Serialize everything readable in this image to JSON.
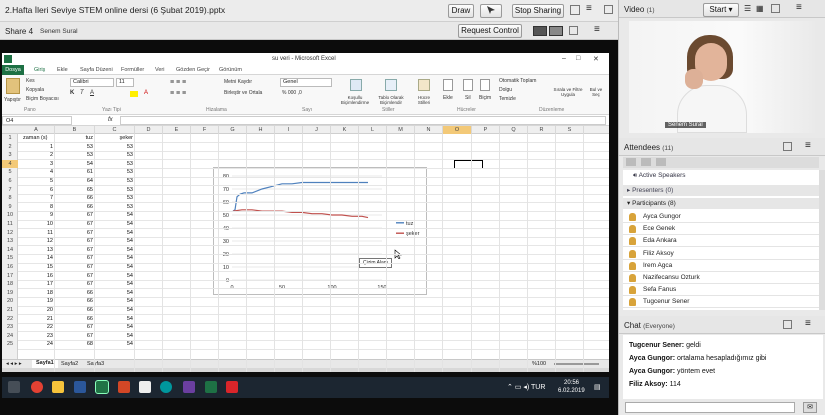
{
  "window": {
    "title": "2.Hafta İleri Seviye STEM online dersi (6 Şubat 2019).pptx",
    "draw": "Draw",
    "stop_sharing": "Stop Sharing"
  },
  "share": {
    "label": "Share 4",
    "presenter": "Senem Sural",
    "request_control": "Request Control"
  },
  "excel": {
    "title": "su veri - Microsoft Excel",
    "tabs": [
      "Dosya",
      "Giriş",
      "Ekle",
      "Sayfa Düzeni",
      "Formüller",
      "Veri",
      "Gözden Geçir",
      "Görünüm"
    ],
    "clipboard": {
      "cut": "Kes",
      "copy": "Kopyala",
      "format_painter": "Biçim Boyacısı",
      "paste": "Yapıştır",
      "group": "Pano"
    },
    "font": {
      "name": "Calibri",
      "size": "11",
      "group": "Yazı Tipi"
    },
    "alignment": {
      "wrap": "Metni Kaydır",
      "merge": "Birleştir ve Ortala",
      "group": "Hizalama"
    },
    "number": {
      "format": "Genel",
      "group": "Sayı"
    },
    "styles": {
      "conditional": "Koşullu Biçimlendirme",
      "table": "Tablo Olarak Biçimlendir",
      "cell": "Hücre Stilleri",
      "group": "Stiller"
    },
    "cells": {
      "insert": "Ekle",
      "delete": "Sil",
      "format": "Biçim",
      "group": "Hücreler"
    },
    "editing": {
      "autosum": "Otomatik Toplam",
      "fill": "Dolgu",
      "clear": "Temizle",
      "sort": "Sırala ve Filtre Uygula",
      "find": "Bul ve Seç",
      "group": "Düzenleme"
    },
    "namebox": "O4",
    "fx": "fx",
    "columns": [
      "A",
      "B",
      "C",
      "D",
      "E",
      "F",
      "G",
      "H",
      "I",
      "J",
      "K",
      "L",
      "M",
      "N",
      "O",
      "P",
      "Q",
      "R",
      "S"
    ],
    "rows": [
      {
        "n": "1",
        "a": "zaman (s)",
        "b": "tuz",
        "c": "şeker"
      },
      {
        "n": "2",
        "a": "1",
        "b": "53",
        "c": "53"
      },
      {
        "n": "3",
        "a": "2",
        "b": "53",
        "c": "53"
      },
      {
        "n": "4",
        "a": "3",
        "b": "54",
        "c": "53"
      },
      {
        "n": "5",
        "a": "4",
        "b": "61",
        "c": "53"
      },
      {
        "n": "6",
        "a": "5",
        "b": "64",
        "c": "53"
      },
      {
        "n": "7",
        "a": "6",
        "b": "65",
        "c": "53"
      },
      {
        "n": "8",
        "a": "7",
        "b": "66",
        "c": "53"
      },
      {
        "n": "9",
        "a": "8",
        "b": "66",
        "c": "53"
      },
      {
        "n": "10",
        "a": "9",
        "b": "67",
        "c": "54"
      },
      {
        "n": "11",
        "a": "10",
        "b": "67",
        "c": "54"
      },
      {
        "n": "12",
        "a": "11",
        "b": "67",
        "c": "54"
      },
      {
        "n": "13",
        "a": "12",
        "b": "67",
        "c": "54"
      },
      {
        "n": "14",
        "a": "13",
        "b": "67",
        "c": "54"
      },
      {
        "n": "15",
        "a": "14",
        "b": "67",
        "c": "54"
      },
      {
        "n": "16",
        "a": "15",
        "b": "67",
        "c": "54"
      },
      {
        "n": "17",
        "a": "16",
        "b": "67",
        "c": "54"
      },
      {
        "n": "18",
        "a": "17",
        "b": "67",
        "c": "54"
      },
      {
        "n": "19",
        "a": "18",
        "b": "66",
        "c": "54"
      },
      {
        "n": "20",
        "a": "19",
        "b": "66",
        "c": "54"
      },
      {
        "n": "21",
        "a": "20",
        "b": "66",
        "c": "54"
      },
      {
        "n": "22",
        "a": "21",
        "b": "66",
        "c": "54"
      },
      {
        "n": "23",
        "a": "22",
        "b": "67",
        "c": "54"
      },
      {
        "n": "24",
        "a": "23",
        "b": "67",
        "c": "54"
      },
      {
        "n": "25",
        "a": "24",
        "b": "68",
        "c": "54"
      }
    ],
    "sheets": [
      "Sayfa1",
      "Sayfa2",
      "Sayfa3"
    ],
    "zoom": "%100",
    "chart_tooltip": "Çizim Alanı"
  },
  "chart_data": {
    "type": "line",
    "xlim": [
      0,
      150
    ],
    "ylim": [
      0,
      80
    ],
    "xticks": [
      0,
      50,
      100,
      150
    ],
    "yticks": [
      0,
      10,
      20,
      30,
      40,
      50,
      60,
      70,
      80
    ],
    "legend_position": "right",
    "series": [
      {
        "name": "tuz",
        "color": "#4f81bd",
        "x": [
          1,
          3,
          5,
          8,
          12,
          20,
          30,
          40,
          50,
          60,
          70,
          80,
          90,
          100,
          110,
          120,
          130,
          136
        ],
        "y": [
          53,
          54,
          64,
          66,
          67,
          67,
          70,
          72,
          74,
          74,
          75,
          75,
          75,
          75,
          75,
          75,
          75,
          75
        ]
      },
      {
        "name": "şeker",
        "color": "#c0504d",
        "x": [
          1,
          10,
          20,
          30,
          40,
          50,
          60,
          70,
          80,
          90,
          100,
          110,
          120,
          130,
          136
        ],
        "y": [
          53,
          54,
          54,
          53,
          53,
          53,
          52,
          52,
          51,
          51,
          50,
          50,
          49,
          49,
          48
        ]
      }
    ]
  },
  "taskbar": {
    "time": "20:56",
    "date": "6.02.2019"
  },
  "video": {
    "label": "Video",
    "count": "(1)",
    "start": "Start",
    "presenter": "Senem Sural"
  },
  "attendees": {
    "label": "Attendees",
    "count": "(11)",
    "active_speakers": "Active Speakers",
    "presenters": "Presenters (0)",
    "participants_label": "Participants (8)",
    "participants": [
      "Ayca Gungor",
      "Ece Genek",
      "Eda Ankara",
      "Filiz Aksoy",
      "Irem Agca",
      "Nazifecansu Ozturk",
      "Sefa Fanus",
      "Tugcenur Sener"
    ]
  },
  "chat": {
    "label": "Chat",
    "scope": "(Everyone)",
    "messages": [
      {
        "who": "Tugcenur Sener:",
        "text": "geldi"
      },
      {
        "who": "Ayca Gungor:",
        "text": "ortalama hesapladığımız gibi"
      },
      {
        "who": "Ayca Gungor:",
        "text": "yöntem evet"
      },
      {
        "who": "Filiz Aksoy:",
        "text": "114"
      }
    ]
  }
}
